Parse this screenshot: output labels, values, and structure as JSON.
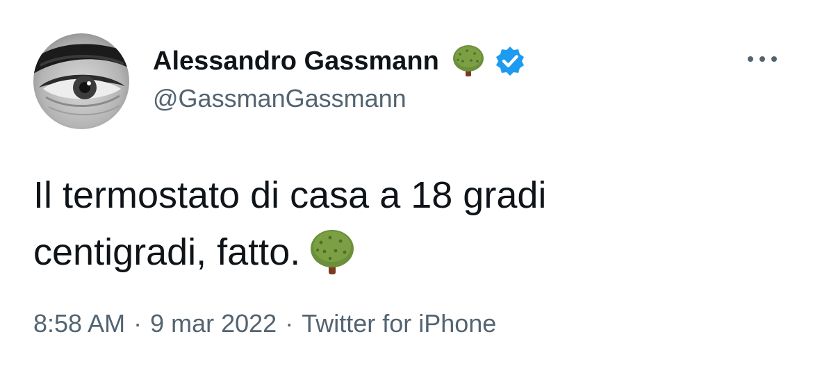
{
  "user": {
    "display_name": "Alessandro Gassmann",
    "handle": "@GassmanGassmann",
    "verified": true,
    "name_emoji": "deciduous-tree"
  },
  "tweet": {
    "text_line_1": "Il termostato di casa a 18 gradi",
    "text_line_2": "centigradi, fatto.",
    "trailing_emoji": "deciduous-tree"
  },
  "meta": {
    "time": "8:58 AM",
    "separator": "·",
    "date": "9 mar 2022",
    "source": "Twitter for iPhone"
  },
  "icons": {
    "more": "more-horizontal-icon",
    "verified": "verified-badge-icon",
    "tree": "tree-emoji-icon"
  },
  "colors": {
    "text_primary": "#0f1419",
    "text_secondary": "#536471",
    "verified_blue": "#1d9bf0",
    "tree_green": "#6b8f3a",
    "tree_trunk": "#7a3b1c"
  }
}
